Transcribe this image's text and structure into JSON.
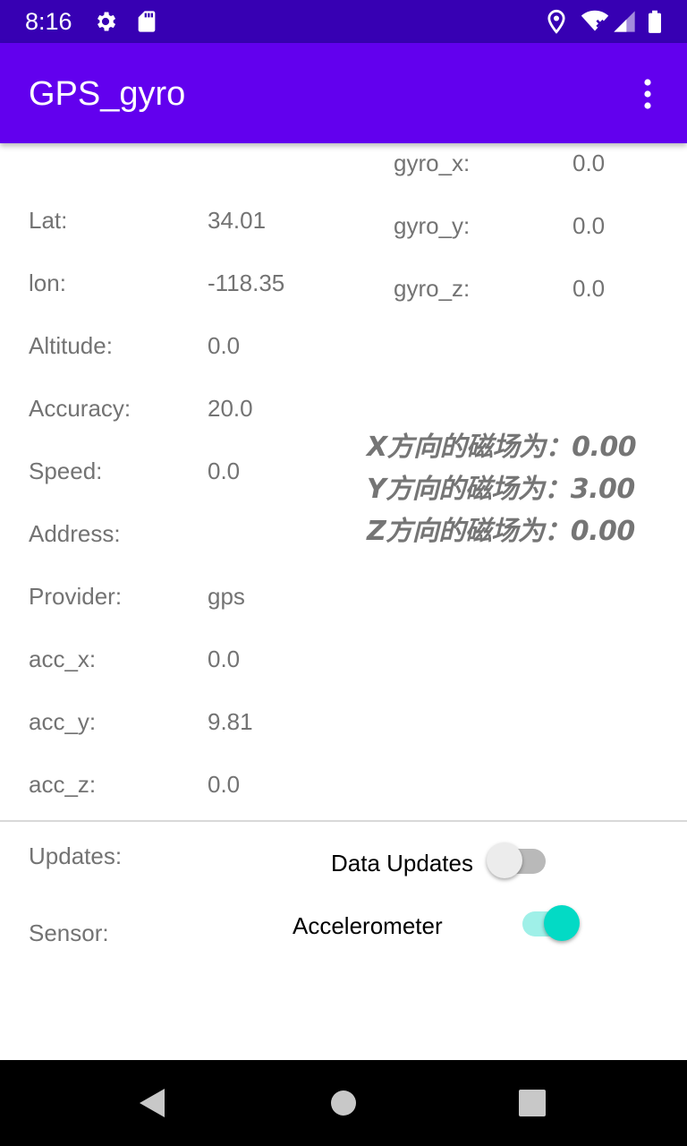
{
  "status_bar": {
    "time": "8:16",
    "icons": [
      "gear-icon",
      "sd-card-icon",
      "location-icon",
      "wifi-icon",
      "signal-icon",
      "battery-icon"
    ]
  },
  "app_bar": {
    "title": "GPS_gyro",
    "menu_icon": "overflow-menu-icon",
    "color": "#6200ee"
  },
  "gps": {
    "lat_label": "Lat:",
    "lat_value": "34.01",
    "lon_label": "lon:",
    "lon_value": "-118.35",
    "altitude_label": "Altitude:",
    "altitude_value": "0.0",
    "accuracy_label": "Accuracy:",
    "accuracy_value": "20.0",
    "speed_label": "Speed:",
    "speed_value": "0.0",
    "address_label": "Address:",
    "address_value": "",
    "provider_label": "Provider:",
    "provider_value": "gps"
  },
  "accelerometer": {
    "x_label": "acc_x:",
    "x_value": "0.0",
    "y_label": "acc_y:",
    "y_value": "9.81",
    "z_label": "acc_z:",
    "z_value": "0.0"
  },
  "gyro": {
    "x_label": "gyro_x:",
    "x_value": "0.0",
    "y_label": "gyro_y:",
    "y_value": "0.0",
    "z_label": "gyro_z:",
    "z_value": "0.0"
  },
  "magnetic": {
    "x_text": "X方向的磁场为：0.00",
    "y_text": "Y方向的磁场为：3.00",
    "z_text": "Z方向的磁场为：0.00"
  },
  "controls": {
    "updates_label": "Updates:",
    "data_updates_switch_label": "Data Updates",
    "data_updates_on": false,
    "sensor_label": "Sensor:",
    "accelerometer_switch_label": "Accelerometer",
    "accelerometer_on": true,
    "accent_color": "#03dac5"
  },
  "nav_bar": {
    "icons": [
      "back-icon",
      "home-icon",
      "recents-icon"
    ]
  }
}
